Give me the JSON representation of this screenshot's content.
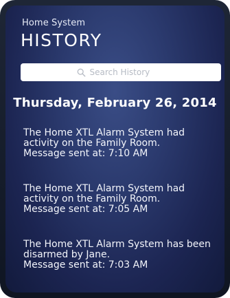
{
  "header": {
    "app_name": "Home System",
    "title": "HISTORY"
  },
  "search": {
    "placeholder": "Search History",
    "icon": "search-icon"
  },
  "date_heading": "Thursday, February 26, 2014",
  "history": [
    {
      "message": "The Home XTL Alarm System had activity on the Family Room.",
      "sent": "Message sent at: 7:10 AM"
    },
    {
      "message": "The Home XTL Alarm System had activity on the Family Room.",
      "sent": "Message sent at: 7:05 AM"
    },
    {
      "message": "The Home XTL Alarm System has been disarmed by Jane.",
      "sent": "Message sent at: 7:03 AM"
    }
  ],
  "colors": {
    "background_top": "#3a4d86",
    "background_bottom": "#121a3c",
    "frame": "#1e2636",
    "text": "#ffffff"
  }
}
